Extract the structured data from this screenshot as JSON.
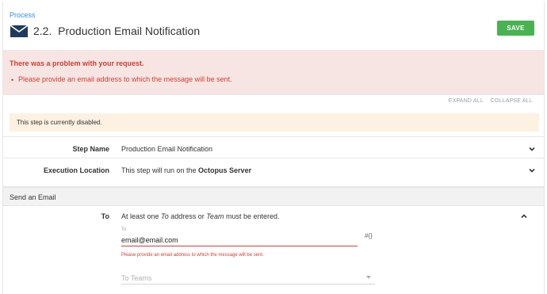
{
  "header": {
    "breadcrumb": "Process",
    "step_number": "2.2.",
    "title": "Production Email Notification",
    "save_label": "SAVE",
    "icon": "envelope-icon"
  },
  "error": {
    "title": "There was a problem with your request.",
    "bullet": "•",
    "message": "Please provide an email address to which the message will be sent."
  },
  "toolbar": {
    "expand_all": "EXPAND ALL",
    "collapse_all": "COLLAPSE ALL"
  },
  "notice": {
    "text": "This step is currently disabled."
  },
  "step_name": {
    "label": "Step Name",
    "value": "Production Email Notification"
  },
  "execution_location": {
    "label": "Execution Location",
    "prefix": "This step will run on the ",
    "server": "Octopus Server"
  },
  "section": {
    "title": "Send an Email"
  },
  "to": {
    "label": "To",
    "hint_a": "At least one ",
    "hint_to": "To",
    "hint_b": " address or ",
    "hint_team": "Team",
    "hint_c": " must be entered.",
    "field_label": "To",
    "value": "email@email.com",
    "variable_button": "#{}",
    "field_error": "Please provide an email address to which the message will be sent.",
    "teams_placeholder": "To Teams"
  },
  "colors": {
    "accent": "#2f93e0",
    "save": "#48b350",
    "error": "#d13d33",
    "error_bg": "#f7e5e3",
    "notice_bg": "#fdf1e2"
  }
}
